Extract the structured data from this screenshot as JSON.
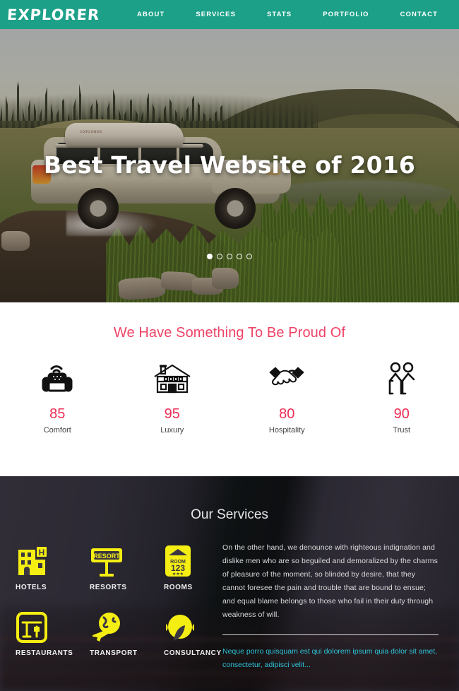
{
  "header": {
    "logo": "EXPLORER",
    "brand_color": "#1ca088",
    "nav": [
      {
        "label": "ABOUT"
      },
      {
        "label": "SERVICES"
      },
      {
        "label": "STATS"
      },
      {
        "label": "PORTFOLIO"
      },
      {
        "label": "CONTACT"
      }
    ]
  },
  "hero": {
    "title": "Best Travel Website of 2016",
    "roofbox_brand": "EXPLORER",
    "slides_total": 5,
    "active_slide": 1
  },
  "stats": {
    "title": "We Have Something To Be Proud Of",
    "title_color": "#ee4266",
    "number_color": "#ee2d55",
    "items": [
      {
        "icon": "armchair-wifi-icon",
        "value": "85",
        "label": "Comfort"
      },
      {
        "icon": "house-icon",
        "value": "95",
        "label": "Luxury"
      },
      {
        "icon": "handshake-icon",
        "value": "80",
        "label": "Hospitality"
      },
      {
        "icon": "two-people-icon",
        "value": "90",
        "label": "Trust"
      }
    ]
  },
  "services": {
    "title": "Our Services",
    "icon_color": "#f5ee12",
    "items": [
      {
        "icon": "hotel-building-icon",
        "label": "HOTELS"
      },
      {
        "icon": "resort-sign-icon",
        "label": "RESORTS"
      },
      {
        "icon": "room-number-tag-icon",
        "label": "ROOMS"
      },
      {
        "icon": "restaurant-table-icon",
        "label": "RESTAURANTS"
      },
      {
        "icon": "globe-plane-icon",
        "label": "TRANSPORT"
      },
      {
        "icon": "headset-support-icon",
        "label": "CONSULTANCY"
      }
    ],
    "paragraph": "On the other hand, we denounce with righteous indignation and dislike men who are so beguiled and demoralized by the charms of pleasure of the moment, so blinded by desire, that they cannot foresee the pain and trouble that are bound to ensue; and equal blame belongs to those who fail in their duty through weakness of will.",
    "quote": "Neque porro quisquam est qui dolorem ipsum quia dolor sit amet, consectetur, adipisci velit...",
    "quote_color": "#2fc4d8"
  }
}
